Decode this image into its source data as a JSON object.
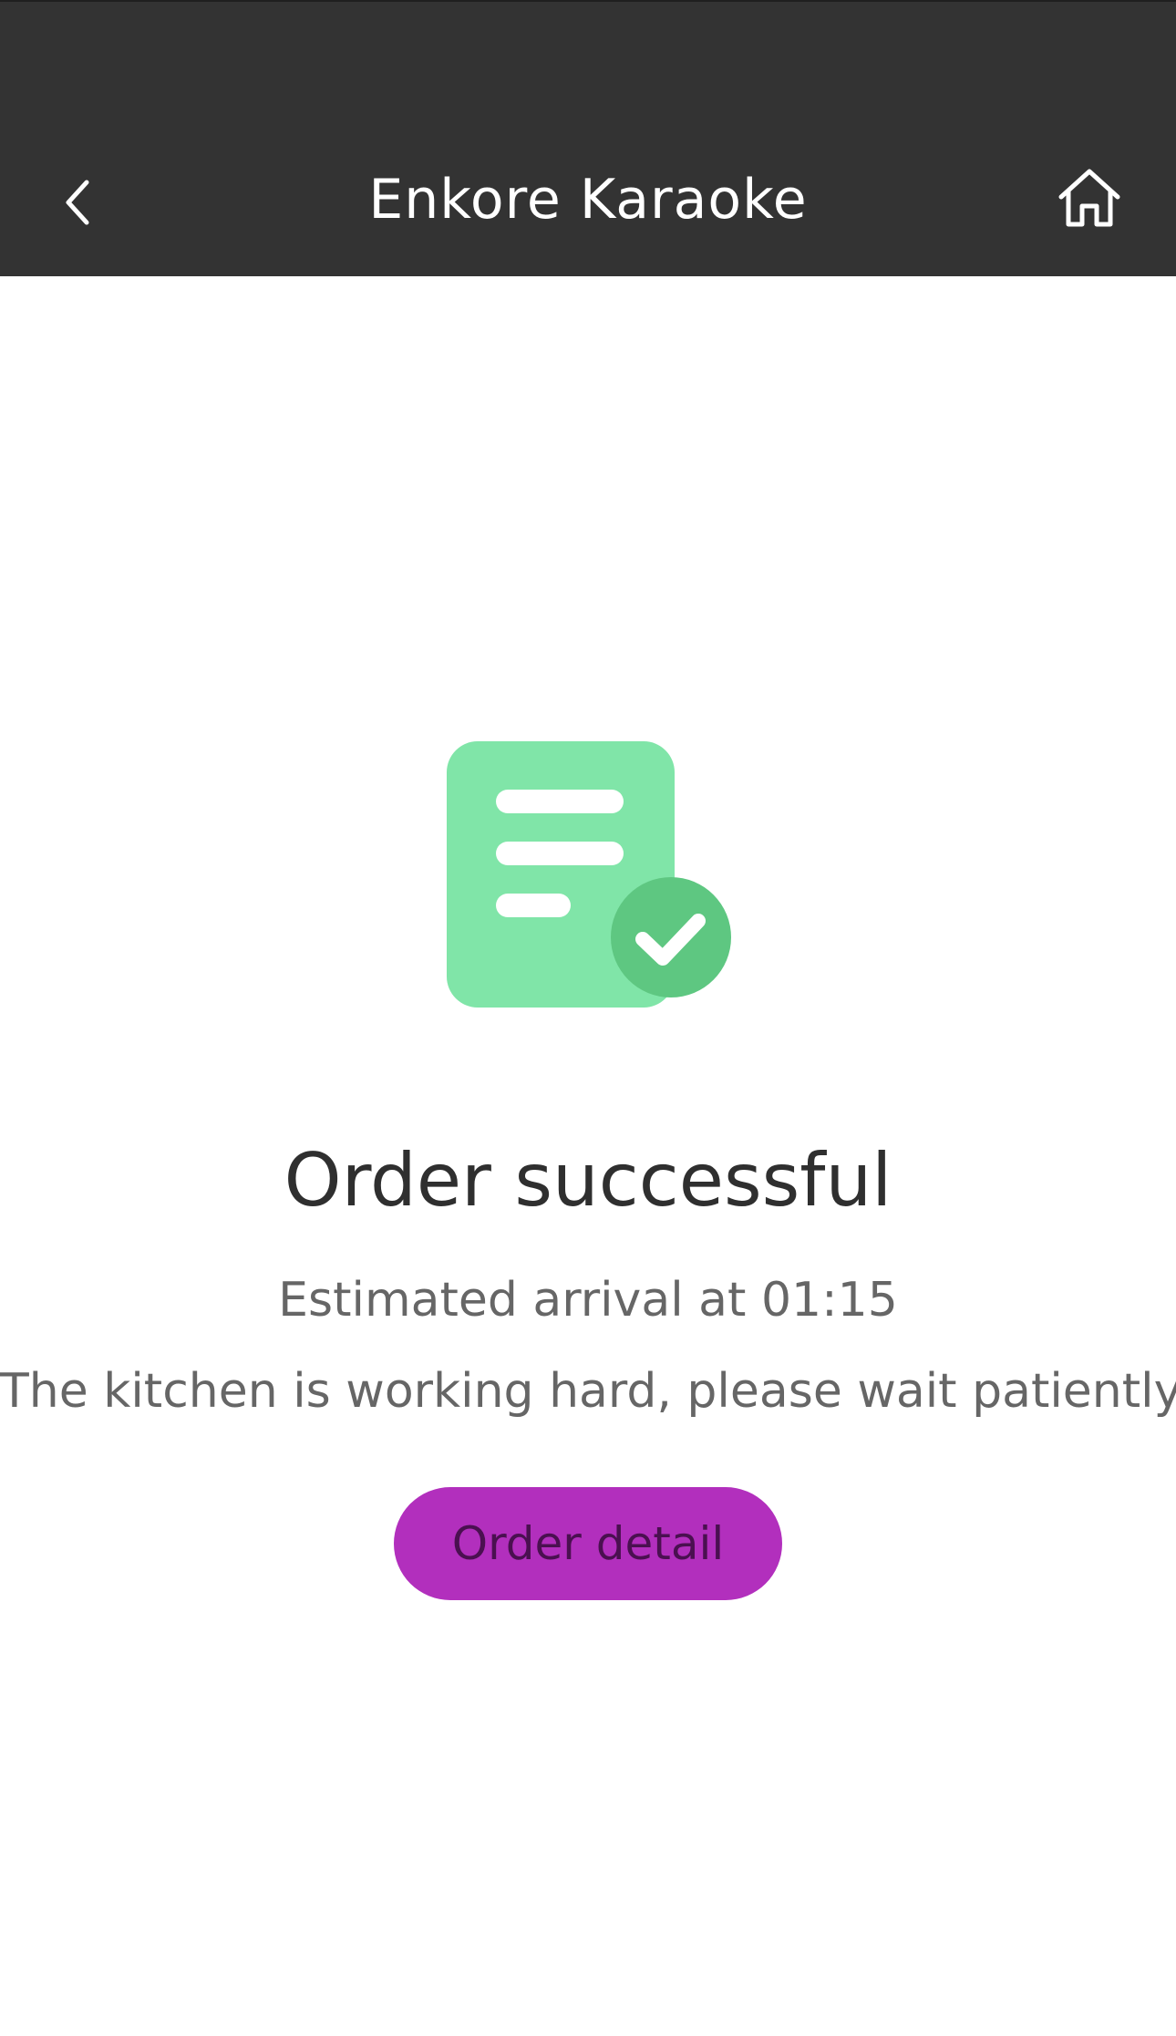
{
  "header": {
    "title": "Enkore Karaoke",
    "back_icon": "chevron-left-icon",
    "home_icon": "home-icon",
    "background": "#333333"
  },
  "main": {
    "illustration_icon": "order-document-check-icon",
    "title": "Order successful",
    "arrival_text": "Estimated arrival at 01:15",
    "kitchen_text": "The kitchen is working hard, please wait patiently~",
    "order_detail_label": "Order detail"
  },
  "colors": {
    "accent": "#b22fbd",
    "doc_green": "#80e5a8",
    "check_green": "#5ec781"
  }
}
